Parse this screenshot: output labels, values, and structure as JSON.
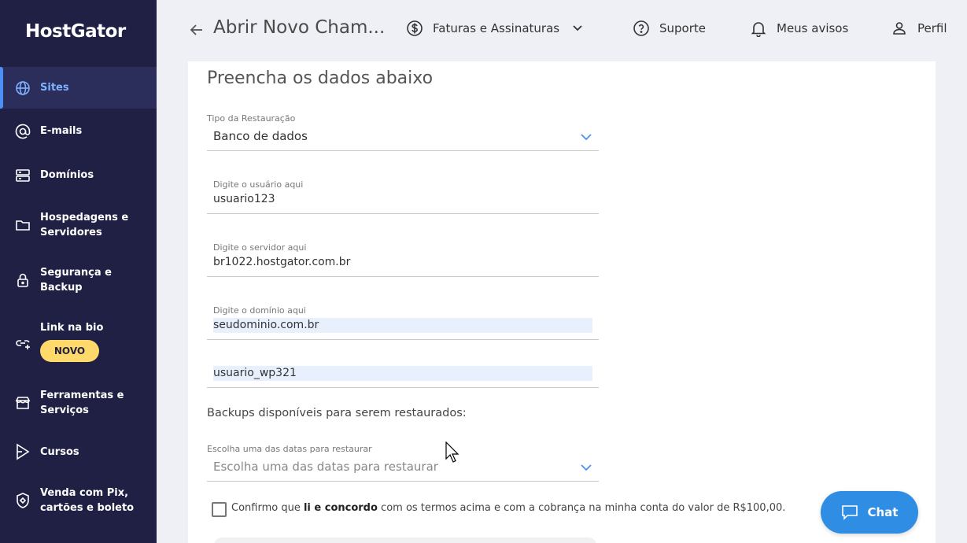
{
  "sidebar": {
    "logo": "HostGator",
    "items": [
      {
        "label": "Sites",
        "icon": "globe-icon"
      },
      {
        "label": "E-mails",
        "icon": "at-icon"
      },
      {
        "label": "Domínios",
        "icon": "server-icon"
      },
      {
        "label": "Hospedagens e Servidores",
        "icon": "folder-icon"
      },
      {
        "label": "Segurança e Backup",
        "icon": "lock-icon"
      },
      {
        "label": "Link na bio",
        "icon": "link-icon",
        "badge": "NOVO"
      },
      {
        "label": "Ferramentas e Serviços",
        "icon": "store-icon"
      },
      {
        "label": "Cursos",
        "icon": "play-icon"
      },
      {
        "label": "Venda com Pix, cartões e boleto",
        "icon": "shield-pix-icon"
      }
    ]
  },
  "header": {
    "title": "Abrir Novo Cham...",
    "billing": "Faturas e Assinaturas",
    "support": "Suporte",
    "notices": "Meus avisos",
    "profile": "Perfil"
  },
  "form": {
    "title": "Preencha os dados abaixo",
    "restore_type": {
      "label": "Tipo da Restauração",
      "value": "Banco de dados"
    },
    "user": {
      "label": "Digite o usuário aqui",
      "value": "usuario123"
    },
    "server": {
      "label": "Digite o servidor aqui",
      "value": "br1022.hostgator.com.br"
    },
    "domain": {
      "label": "Digite o domínio aqui",
      "value": "seudominio.com.br"
    },
    "db_user": {
      "value": "usuario_wp321"
    },
    "backups_label": "Backups disponíveis para serem restaurados:",
    "date_select": {
      "label": "Escolha uma das datas para restaurar",
      "placeholder": "Escolha uma das datas para restaurar"
    },
    "confirm": {
      "pre": "Confirmo que ",
      "bold": "li e concordo",
      "post": " com os termos acima e com a cobrança na minha conta do valor de R$100,00."
    }
  },
  "chat": {
    "label": "Chat"
  },
  "colors": {
    "sidebar": "#1f2044",
    "accent": "#2f8ee3",
    "badge": "#ffd96a",
    "active_text": "#7fb2ff"
  }
}
